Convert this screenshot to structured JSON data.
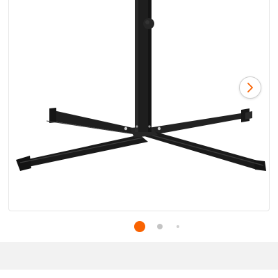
{
  "gallery": {
    "image_icon": "umbrella-cross-base-stand",
    "next_icon": "chevron-right-icon",
    "slide_count": 3,
    "active_slide": 1
  },
  "colors": {
    "active_dot": "#f96302",
    "inactive_dot": "#c4c4c4",
    "small_dot": "#d0d0d0",
    "band": "#f2f2f2",
    "stand": "#1c1c1c",
    "chevron": "#f96302"
  }
}
